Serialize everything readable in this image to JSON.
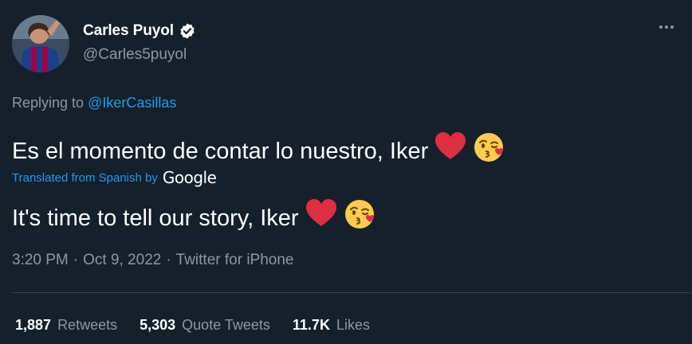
{
  "tweet": {
    "author": {
      "name": "Carles Puyol",
      "handle": "@Carles5puyol",
      "verified": true
    },
    "reply": {
      "prefix": "Replying to ",
      "target": "@IkerCasillas"
    },
    "original_text": "Es el momento de contar lo nuestro, Iker",
    "translation": {
      "note": "Translated from Spanish by",
      "provider": "Google",
      "text": "It's time to tell our story, Iker"
    },
    "emojis": [
      "red-heart",
      "face-blowing-a-kiss"
    ],
    "meta": {
      "time": "3:20 PM",
      "separator": "·",
      "date": "Oct 9, 2022",
      "source": "Twitter for iPhone"
    },
    "stats": {
      "retweets_count": "1,887",
      "retweets_label": "Retweets",
      "quotes_count": "5,303",
      "quotes_label": "Quote Tweets",
      "likes_count": "11.7K",
      "likes_label": "Likes"
    }
  },
  "colors": {
    "background": "#15202b",
    "primary_text": "#ffffff",
    "secondary_text": "#8b98a5",
    "accent": "#1d9bf0",
    "divider": "#38444d"
  }
}
